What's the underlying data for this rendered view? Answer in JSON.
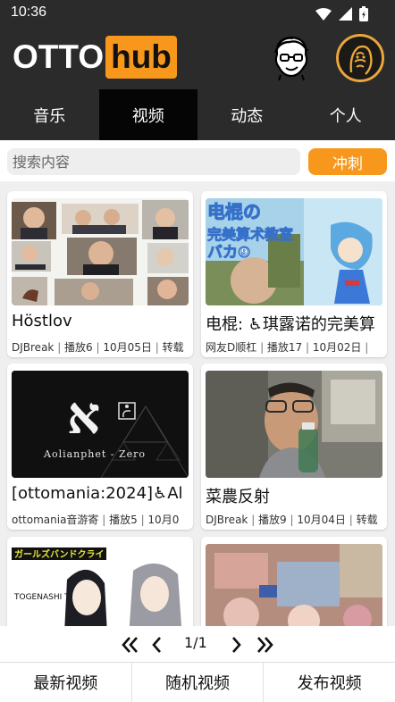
{
  "status": {
    "time": "10:36"
  },
  "header": {
    "logo_left": "OTTO",
    "logo_right": "hub"
  },
  "tabs": [
    {
      "label": "音乐",
      "active": false
    },
    {
      "label": "视频",
      "active": true
    },
    {
      "label": "动态",
      "active": false
    },
    {
      "label": "个人",
      "active": false
    }
  ],
  "search": {
    "placeholder": "搜索内容",
    "button": "冲刺"
  },
  "videos": [
    {
      "title": "Höstlov",
      "author": "DJBreak",
      "plays": "播放6",
      "date": "10月05日",
      "extra": "转载"
    },
    {
      "title": "电棍: ♿琪露诺的完美算",
      "author": "网友D顺杠",
      "plays": "播放17",
      "date": "10月02日",
      "extra": ""
    },
    {
      "title": "[ottomania:2024]♿Al",
      "author": "ottomania音游寄",
      "plays": "播放5",
      "date": "10月0",
      "extra": ""
    },
    {
      "title": "菜農反射",
      "author": "DJBreak",
      "plays": "播放9",
      "date": "10月04日",
      "extra": "转载"
    }
  ],
  "thumb_text": {
    "aleph": "א",
    "aolianphet": "Aolianphet - Zero",
    "dengun": "电棍の",
    "wanmei": "完美算术教室",
    "baka": "バカ⑨",
    "girls": "ガールズバンドクライ",
    "toge": "TOGENASHI TOGEARI"
  },
  "pager": {
    "page": "1/1"
  },
  "bottom_nav": {
    "latest": "最新视频",
    "random": "随机视频",
    "publish": "发布视频"
  },
  "colors": {
    "accent": "#f7981d",
    "header": "#2b2b2b",
    "active_tab": "#050505"
  },
  "icons": [
    "wifi-icon",
    "signal-icon",
    "battery-icon",
    "face-icon",
    "first-page-icon",
    "prev-page-icon",
    "next-page-icon",
    "last-page-icon",
    "accessibility-icon"
  ]
}
